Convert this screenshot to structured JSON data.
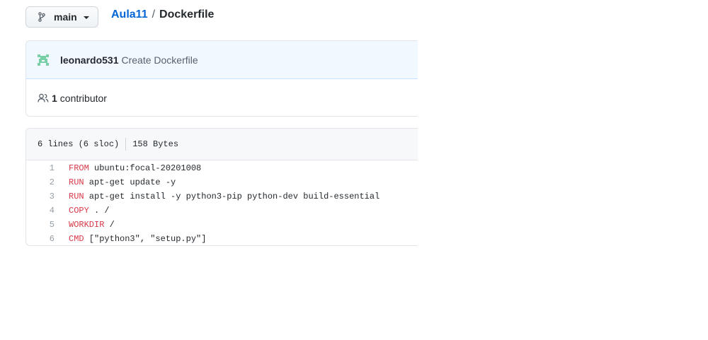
{
  "branch": {
    "name": "main",
    "icon": "git-branch-icon"
  },
  "breadcrumb": {
    "repo": "Aula11",
    "separator": "/",
    "file": "Dockerfile"
  },
  "commit": {
    "avatar_icon": "identicon-avatar",
    "author": "leonardo531",
    "message": "Create Dockerfile"
  },
  "contributors": {
    "icon": "people-icon",
    "count": "1",
    "label": "contributor"
  },
  "file": {
    "lines_info": "6 lines (6 sloc)",
    "size": "158 Bytes",
    "lines": [
      {
        "num": "1",
        "keyword": "FROM",
        "rest": " ubuntu:focal-20201008"
      },
      {
        "num": "2",
        "keyword": "RUN",
        "rest": " apt-get update -y"
      },
      {
        "num": "3",
        "keyword": "RUN",
        "rest": " apt-get install -y python3-pip python-dev build-essential"
      },
      {
        "num": "4",
        "keyword": "COPY",
        "rest": " . /"
      },
      {
        "num": "5",
        "keyword": "WORKDIR",
        "rest": " /"
      },
      {
        "num": "6",
        "keyword": "CMD",
        "rest": " [\"python3\", \"setup.py\"]"
      }
    ]
  },
  "colors": {
    "link": "#0366d6",
    "keyword": "#d73a49",
    "commit_bg": "#f1f8ff",
    "avatar": "#79d0a6"
  }
}
